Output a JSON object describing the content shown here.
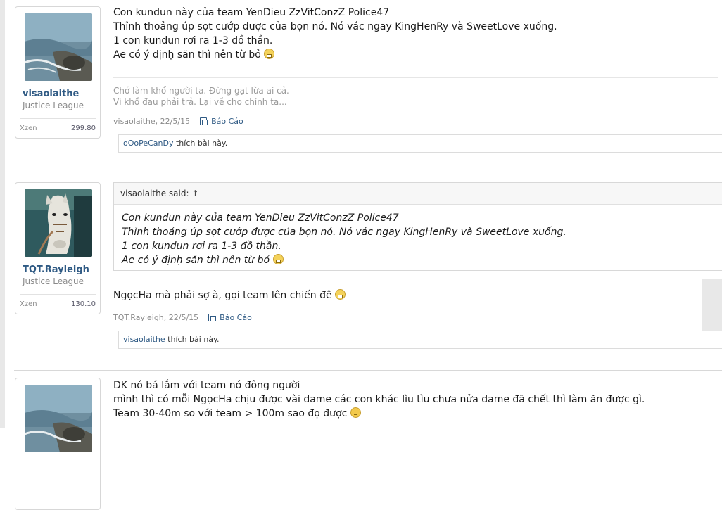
{
  "posts": [
    {
      "author": "visaolaithe",
      "user_title": "Justice League",
      "stat_label": "Xzen",
      "stat_value": "299.80",
      "message": [
        "Con kundun này của team YenDieu ZzVitConzZ Police47",
        "Thỉnh thoảng úp sọt cướp được của bọn nó. Nó vác ngay KingHenRy và SweetLove xuống.",
        "1 con kundun rơi ra 1-3 đồ thần.",
        "Ae có ý địnḥ săn thì nên từ bỏ"
      ],
      "signature": [
        "Chớ làm khổ người ta. Đừng gạt lừa ai cả.",
        "Vì khổ đau phải trả. Lại về cho chính ta..."
      ],
      "meta": "visaolaithe, 22/5/15",
      "report_label": "Báo Cáo",
      "likes_user": "oOoPeCanDy",
      "likes_text": " thích bài này."
    },
    {
      "author": "TQT.Rayleigh",
      "user_title": "Justice League",
      "stat_label": "Xzen",
      "stat_value": "130.10",
      "quote_header": "visaolaithe said: ↑",
      "quote": [
        "Con kundun này của team YenDieu ZzVitConzZ Police47",
        "Thỉnh thoảng úp sọt cướp được của bọn nó. Nó vác ngay KingHenRy và SweetLove xuống.",
        "1 con kundun rơi ra 1-3 đồ thần.",
        "Ae có ý địnḥ săn thì nên từ bỏ"
      ],
      "message": [
        "NgọcHa mà phải sợ à, gọi team lên chiến đê"
      ],
      "meta": "TQT.Rayleigh, 22/5/15",
      "report_label": "Báo Cáo",
      "likes_user": "visaolaithe",
      "likes_text": " thích bài này."
    },
    {
      "message": [
        "DK nó bá lắm với team nó đông người",
        "mình thì có mỗi NgọcHa chịu được vài dame các con khác lìu tìu chưa nửa dame đã chết thì làm ăn được gì.",
        "Team 30-40m so với team > 100m sao đọ được"
      ]
    }
  ],
  "icons": {
    "grin": "grin-emoji-icon",
    "worried": "worried-emoji-icon",
    "report": "report-icon"
  },
  "colors": {
    "link": "#2f5a84",
    "muted": "#8a8a8a",
    "border": "#d7d7d7"
  }
}
